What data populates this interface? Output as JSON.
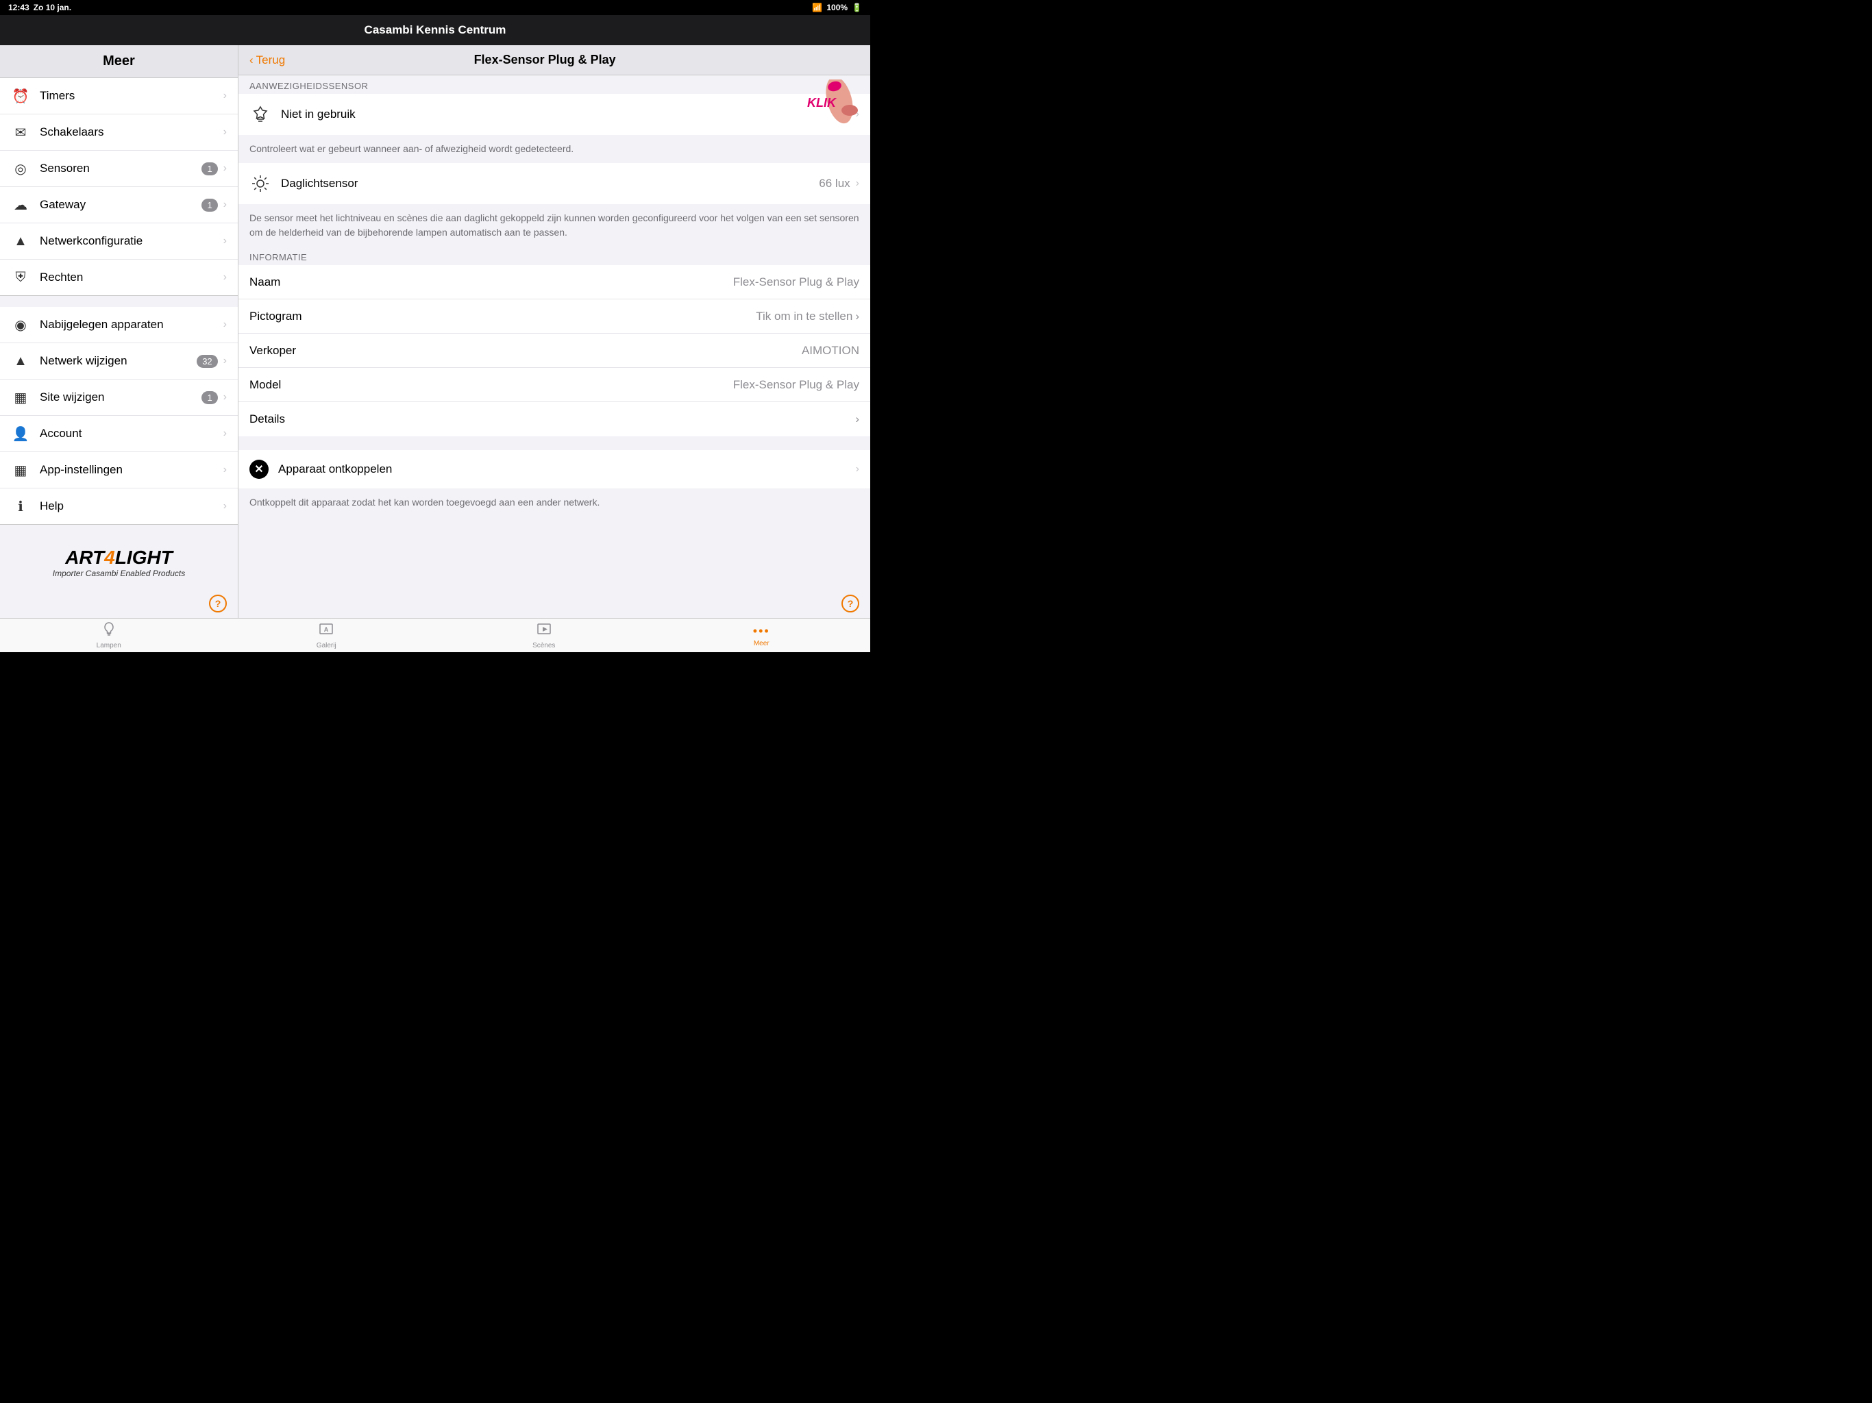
{
  "statusBar": {
    "time": "12:43",
    "day": "Zo 10 jan.",
    "wifi": "wifi",
    "battery": "100%"
  },
  "appHeader": {
    "title": "Casambi Kennis Centrum"
  },
  "sidebar": {
    "header": "Meer",
    "items": [
      {
        "id": "timers",
        "icon": "⏰",
        "label": "Timers",
        "badge": null
      },
      {
        "id": "schakelaars",
        "icon": "✉",
        "label": "Schakelaars",
        "badge": null
      },
      {
        "id": "sensoren",
        "icon": "◎",
        "label": "Sensoren",
        "badge": "1"
      },
      {
        "id": "gateway",
        "icon": "☁",
        "label": "Gateway",
        "badge": "1"
      },
      {
        "id": "netwerkconfiguratie",
        "icon": "▲",
        "label": "Netwerkconfiguratie",
        "badge": null
      },
      {
        "id": "rechten",
        "icon": "⛨",
        "label": "Rechten",
        "badge": null
      }
    ],
    "itemsSection2": [
      {
        "id": "nabijgelegen",
        "icon": "◉",
        "label": "Nabijgelegen apparaten",
        "badge": null
      },
      {
        "id": "netwerk-wijzigen",
        "icon": "▲",
        "label": "Netwerk wijzigen",
        "badge": "32"
      },
      {
        "id": "site-wijzigen",
        "icon": "▦",
        "label": "Site wijzigen",
        "badge": "1"
      },
      {
        "id": "account",
        "icon": "👤",
        "label": "Account",
        "badge": null
      },
      {
        "id": "app-instellingen",
        "icon": "▦",
        "label": "App-instellingen",
        "badge": null
      },
      {
        "id": "help",
        "icon": "ℹ",
        "label": "Help",
        "badge": null
      }
    ],
    "logo": {
      "line1_pre": "ART",
      "line1_num": "4",
      "line1_post": "LIGHT",
      "subtitle": "Importer Casambi Enabled Products"
    }
  },
  "rightPanel": {
    "backLabel": "Terug",
    "title": "Flex-Sensor Plug & Play",
    "sections": {
      "aanwezigheidssensor": {
        "label": "AANWEZIGHEIDSSENSOR",
        "items": [
          {
            "icon": "🔔",
            "label": "Niet in gebruik",
            "value": null,
            "hasChevron": true
          }
        ],
        "description": "Controleert wat er gebeurt wanneer aan- of afwezigheid wordt gedetecteerd."
      },
      "daglichtsensor": {
        "items": [
          {
            "icon": "☀",
            "label": "Daglichtsensor",
            "value": "66 lux",
            "hasChevron": true
          }
        ],
        "description": "De sensor meet het lichtniveau en scènes die aan daglicht gekoppeld zijn kunnen worden geconfigureerd voor het volgen van een set sensoren om de helderheid van de bijbehorende lampen automatisch aan te passen."
      },
      "informatie": {
        "label": "INFORMATIE",
        "rows": [
          {
            "label": "Naam",
            "value": "Flex-Sensor Plug & Play",
            "hasChevron": false
          },
          {
            "label": "Pictogram",
            "value": "Tik om in te stellen",
            "hasChevron": true
          },
          {
            "label": "Verkoper",
            "value": "AIMOTION",
            "hasChevron": false
          },
          {
            "label": "Model",
            "value": "Flex-Sensor Plug & Play",
            "hasChevron": false
          },
          {
            "label": "Details",
            "value": null,
            "hasChevron": true
          }
        ]
      },
      "disconnect": {
        "label": "Apparaat ontkoppelen",
        "description": "Ontkoppelt dit apparaat zodat het kan worden toegevoegd aan een ander netwerk."
      }
    }
  },
  "tabBar": {
    "items": [
      {
        "id": "lampen",
        "icon": "💡",
        "label": "Lampen",
        "active": false
      },
      {
        "id": "galerij",
        "icon": "🖼",
        "label": "Galerij",
        "active": false
      },
      {
        "id": "scenes",
        "icon": "🎬",
        "label": "Scènes",
        "active": false
      },
      {
        "id": "meer",
        "icon": "•••",
        "label": "Meer",
        "active": true
      }
    ]
  },
  "overlay": {
    "klik": "KLIK"
  }
}
